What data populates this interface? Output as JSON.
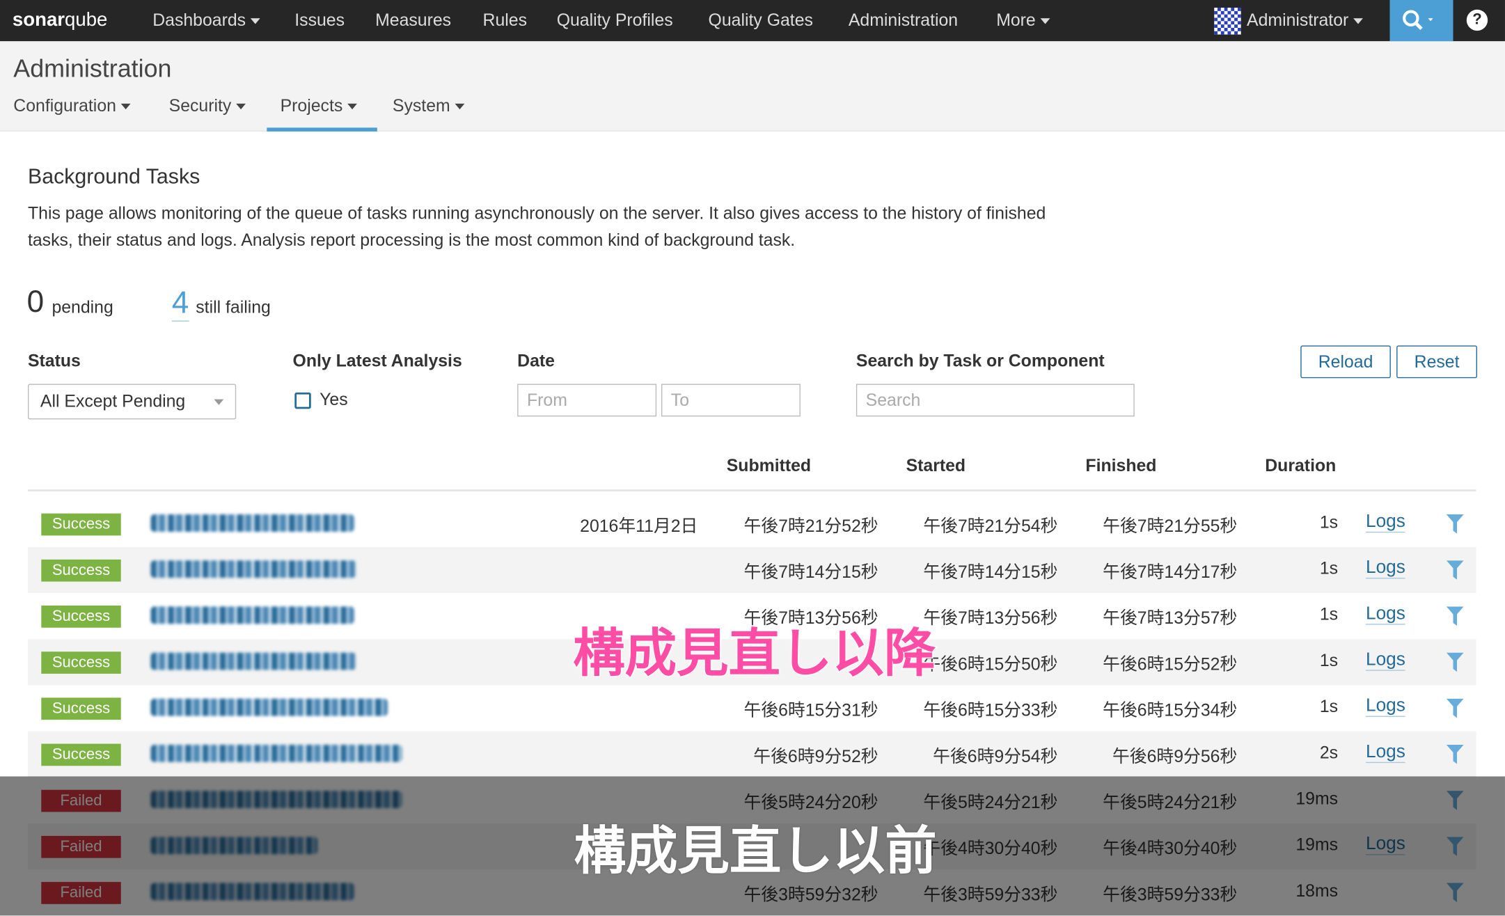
{
  "topnav": {
    "logo": "sonarqube",
    "items": [
      "Dashboards",
      "Issues",
      "Measures",
      "Rules",
      "Quality Profiles",
      "Quality Gates",
      "Administration",
      "More"
    ],
    "user": "Administrator",
    "help": "?"
  },
  "header": {
    "title": "Administration",
    "tabs": [
      "Configuration",
      "Security",
      "Projects",
      "System"
    ],
    "active_tab": "Projects"
  },
  "page": {
    "title": "Background Tasks",
    "description_1": "This page allows monitoring of the queue of tasks running asynchronously on the server. It also gives access to the history of finished",
    "description_2": "tasks, their status and logs. Analysis report processing is the most common kind of background task."
  },
  "stats": {
    "pending_count": "0",
    "pending_label": "pending",
    "failing_count": "4",
    "failing_label": "still failing"
  },
  "filters": {
    "status_label": "Status",
    "status_value": "All Except Pending",
    "latest_label": "Only Latest Analysis",
    "latest_option": "Yes",
    "date_label": "Date",
    "from_placeholder": "From",
    "to_placeholder": "To",
    "search_label": "Search by Task or Component",
    "search_placeholder": "Search",
    "reload": "Reload",
    "reset": "Reset"
  },
  "table": {
    "headers": [
      "Submitted",
      "Started",
      "Finished",
      "Duration"
    ],
    "rows": [
      {
        "status": "Success",
        "date": "2016年11月2日",
        "submitted": "午後7時21分52秒",
        "started": "午後7時21分54秒",
        "finished": "午後7時21分55秒",
        "duration": "1s",
        "logs": "Logs"
      },
      {
        "status": "Success",
        "date": "",
        "submitted": "午後7時14分15秒",
        "started": "午後7時14分15秒",
        "finished": "午後7時14分17秒",
        "duration": "1s",
        "logs": "Logs"
      },
      {
        "status": "Success",
        "date": "",
        "submitted": "午後7時13分56秒",
        "started": "午後7時13分56秒",
        "finished": "午後7時13分57秒",
        "duration": "1s",
        "logs": "Logs"
      },
      {
        "status": "Success",
        "date": "",
        "submitted": "",
        "started": "午後6時15分50秒",
        "finished": "午後6時15分52秒",
        "duration": "1s",
        "logs": "Logs"
      },
      {
        "status": "Success",
        "date": "",
        "submitted": "午後6時15分31秒",
        "started": "午後6時15分33秒",
        "finished": "午後6時15分34秒",
        "duration": "1s",
        "logs": "Logs"
      },
      {
        "status": "Success",
        "date": "",
        "submitted": "午後6時9分52秒",
        "started": "午後6時9分54秒",
        "finished": "午後6時9分56秒",
        "duration": "2s",
        "logs": "Logs"
      },
      {
        "status": "Failed",
        "date": "",
        "submitted": "午後5時24分20秒",
        "started": "午後5時24分21秒",
        "finished": "午後5時24分21秒",
        "duration": "19ms",
        "logs": ""
      },
      {
        "status": "Failed",
        "date": "",
        "submitted": "",
        "started": "午後4時30分40秒",
        "finished": "午後4時30分40秒",
        "duration": "19ms",
        "logs": "Logs"
      },
      {
        "status": "Failed",
        "date": "",
        "submitted": "午後3時59分32秒",
        "started": "午後3時59分33秒",
        "finished": "午後3時59分33秒",
        "duration": "18ms",
        "logs": ""
      }
    ]
  },
  "annotations": {
    "after": "構成見直し以降",
    "before": "構成見直し以前"
  },
  "colors": {
    "success": "#7cb342",
    "failed": "#d4333f",
    "accent": "#4b9fd5",
    "link": "#236a97",
    "after_caption": "#ff4da6"
  }
}
